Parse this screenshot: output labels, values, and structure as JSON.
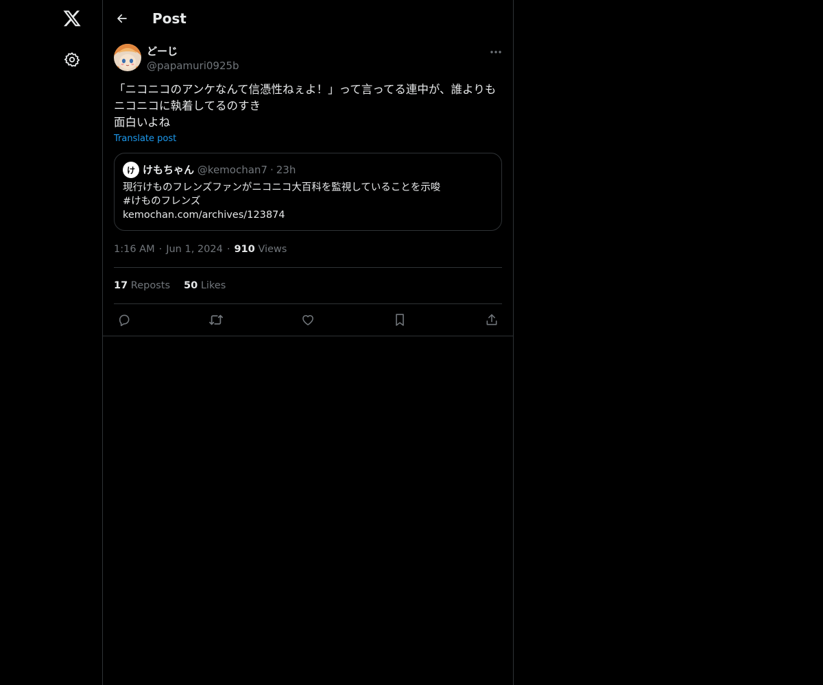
{
  "nav": {
    "logo_icon": "x-logo-icon",
    "settings_icon": "gear-icon"
  },
  "header": {
    "back_icon": "arrow-left-icon",
    "title": "Post"
  },
  "post": {
    "author": {
      "name": "どーじ",
      "handle": "@papamuri0925b"
    },
    "text": "「ニコニコのアンケなんて信憑性ねぇよ！」って言ってる連中が、誰よりもニコニコに執着してるのすき\n面白いよね",
    "translate_label": "Translate post",
    "quote": {
      "avatar_letter": "け",
      "name": "けもちゃん",
      "handle": "@kemochan7",
      "separator": "·",
      "time": "23h",
      "text": "現行けものフレンズファンがニコニコ大百科を監視していることを示唆\n#けものフレンズ\nkemochan.com/archives/123874"
    },
    "time": "1:16 AM",
    "date": "Jun 1, 2024",
    "meta_separator": "·",
    "views_count": "910",
    "views_label": "Views",
    "reposts_count": "17",
    "reposts_label": "Reposts",
    "likes_count": "50",
    "likes_label": "Likes"
  },
  "actions": {
    "reply_icon": "reply-icon",
    "repost_icon": "repost-icon",
    "like_icon": "heart-icon",
    "bookmark_icon": "bookmark-icon",
    "share_icon": "share-icon"
  },
  "colors": {
    "background": "#000000",
    "text_primary": "#e7e9ea",
    "text_secondary": "#71767b",
    "accent": "#1d9bf0",
    "border": "#2f3336"
  }
}
